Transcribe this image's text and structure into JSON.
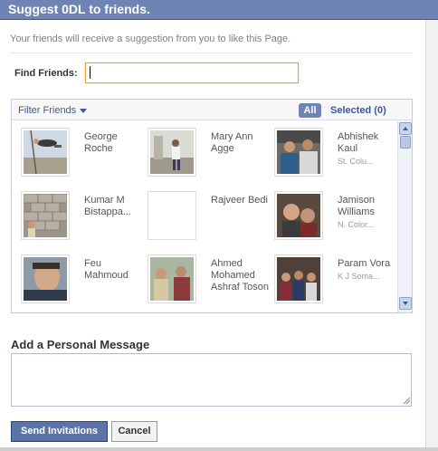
{
  "dialog": {
    "title": "Suggest 0DL to friends.",
    "intro": "Your friends will receive a suggestion from you to like this Page."
  },
  "find": {
    "label": "Find Friends:",
    "value": "",
    "placeholder": ""
  },
  "filter": {
    "filter_label": "Filter Friends",
    "all_label": "All",
    "selected_label": "Selected (0)"
  },
  "friends": [
    {
      "name": "George Roche",
      "network": "",
      "photo": "rope-climb"
    },
    {
      "name": "Mary Ann Agge",
      "network": "",
      "photo": "standing-person"
    },
    {
      "name": "Abhishek Kaul",
      "network": "St. Colu...",
      "photo": "two-friends"
    },
    {
      "name": "Kumar M Bistappa...",
      "network": "",
      "photo": "stone-wall"
    },
    {
      "name": "Rajveer Bedi",
      "network": "",
      "photo": "blank"
    },
    {
      "name": "Jamison Williams",
      "network": "N. Color...",
      "photo": "couple-selfie"
    },
    {
      "name": "Feu Mahmoud",
      "network": "",
      "photo": "face-closeup"
    },
    {
      "name": "Ahmed Mohamed Ashraf Toson",
      "network": "",
      "photo": "group-outdoor"
    },
    {
      "name": "Param Vora",
      "network": "K J Soma...",
      "photo": "group-indoor"
    }
  ],
  "message": {
    "label": "Add a Personal Message",
    "value": ""
  },
  "buttons": {
    "send_label": "Send Invitations",
    "cancel_label": "Cancel"
  },
  "icons": {
    "filter_dropdown": "chevron-down-icon",
    "scroll_up": "scroll-up-icon",
    "scroll_down": "scroll-down-icon",
    "resize": "resize-grip-icon"
  },
  "colors": {
    "title_bar": "#6d84b4",
    "link": "#3b5998",
    "focus_border": "#e2a440",
    "send_button": "#5b74a8"
  }
}
